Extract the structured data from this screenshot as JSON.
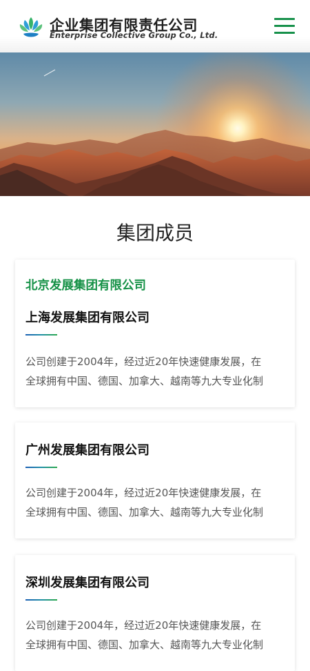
{
  "header": {
    "brand_cn": "企业集团有限责任公司",
    "brand_en": "Enterprise Collective Group Co., Ltd.",
    "logo_icon": "leaf-logo-icon",
    "menu_icon": "hamburger-menu-icon",
    "accent_color": "#16904a"
  },
  "banner": {
    "image": "mountain-sunset-banner"
  },
  "section": {
    "title": "集团成员"
  },
  "cards": [
    {
      "tag": "北京发展集团有限公司",
      "title": "上海发展集团有限公司",
      "desc_line1": "公司创建于2004年，经过近20年快速健康发展，在",
      "desc_line2": "全球拥有中国、德国、加拿大、越南等九大专业化制"
    },
    {
      "title": "广州发展集团有限公司",
      "desc_line1": "公司创建于2004年，经过近20年快速健康发展，在",
      "desc_line2": "全球拥有中国、德国、加拿大、越南等九大专业化制"
    },
    {
      "title": "深圳发展集团有限公司",
      "desc_line1": "公司创建于2004年，经过近20年快速健康发展，在",
      "desc_line2": "全球拥有中国、德国、加拿大、越南等九大专业化制"
    }
  ],
  "colors": {
    "brand_green": "#159146",
    "accent_blue": "#1a5fb4"
  }
}
